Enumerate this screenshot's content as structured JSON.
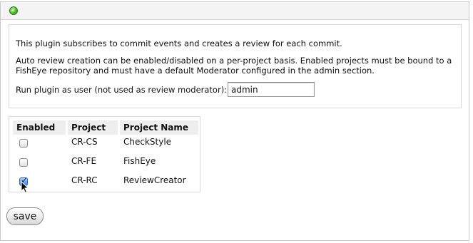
{
  "panel": {
    "status_icon": "status-ok-icon",
    "status_color": "#4cbc2a"
  },
  "info": {
    "intro": "This plugin subscribes to commit events and creates a review for each commit.",
    "auto_line1": "Auto review creation can be enabled/disabled on a per-project basis. Enabled projects must be bound to a",
    "auto_line2": "FishEye repository and must have a default Moderator configured in the admin section.",
    "run_as_label": "Run plugin as user (not used as review moderator):",
    "run_as_value": "admin"
  },
  "projects": {
    "headers": [
      "Enabled",
      "Project",
      "Project Name"
    ],
    "rows": [
      {
        "enabled": false,
        "project": "CR-CS",
        "name": "CheckStyle"
      },
      {
        "enabled": false,
        "project": "CR-FE",
        "name": "FishEye"
      },
      {
        "enabled": true,
        "project": "CR-RC",
        "name": "ReviewCreator"
      }
    ]
  },
  "actions": {
    "save_label": "save"
  }
}
